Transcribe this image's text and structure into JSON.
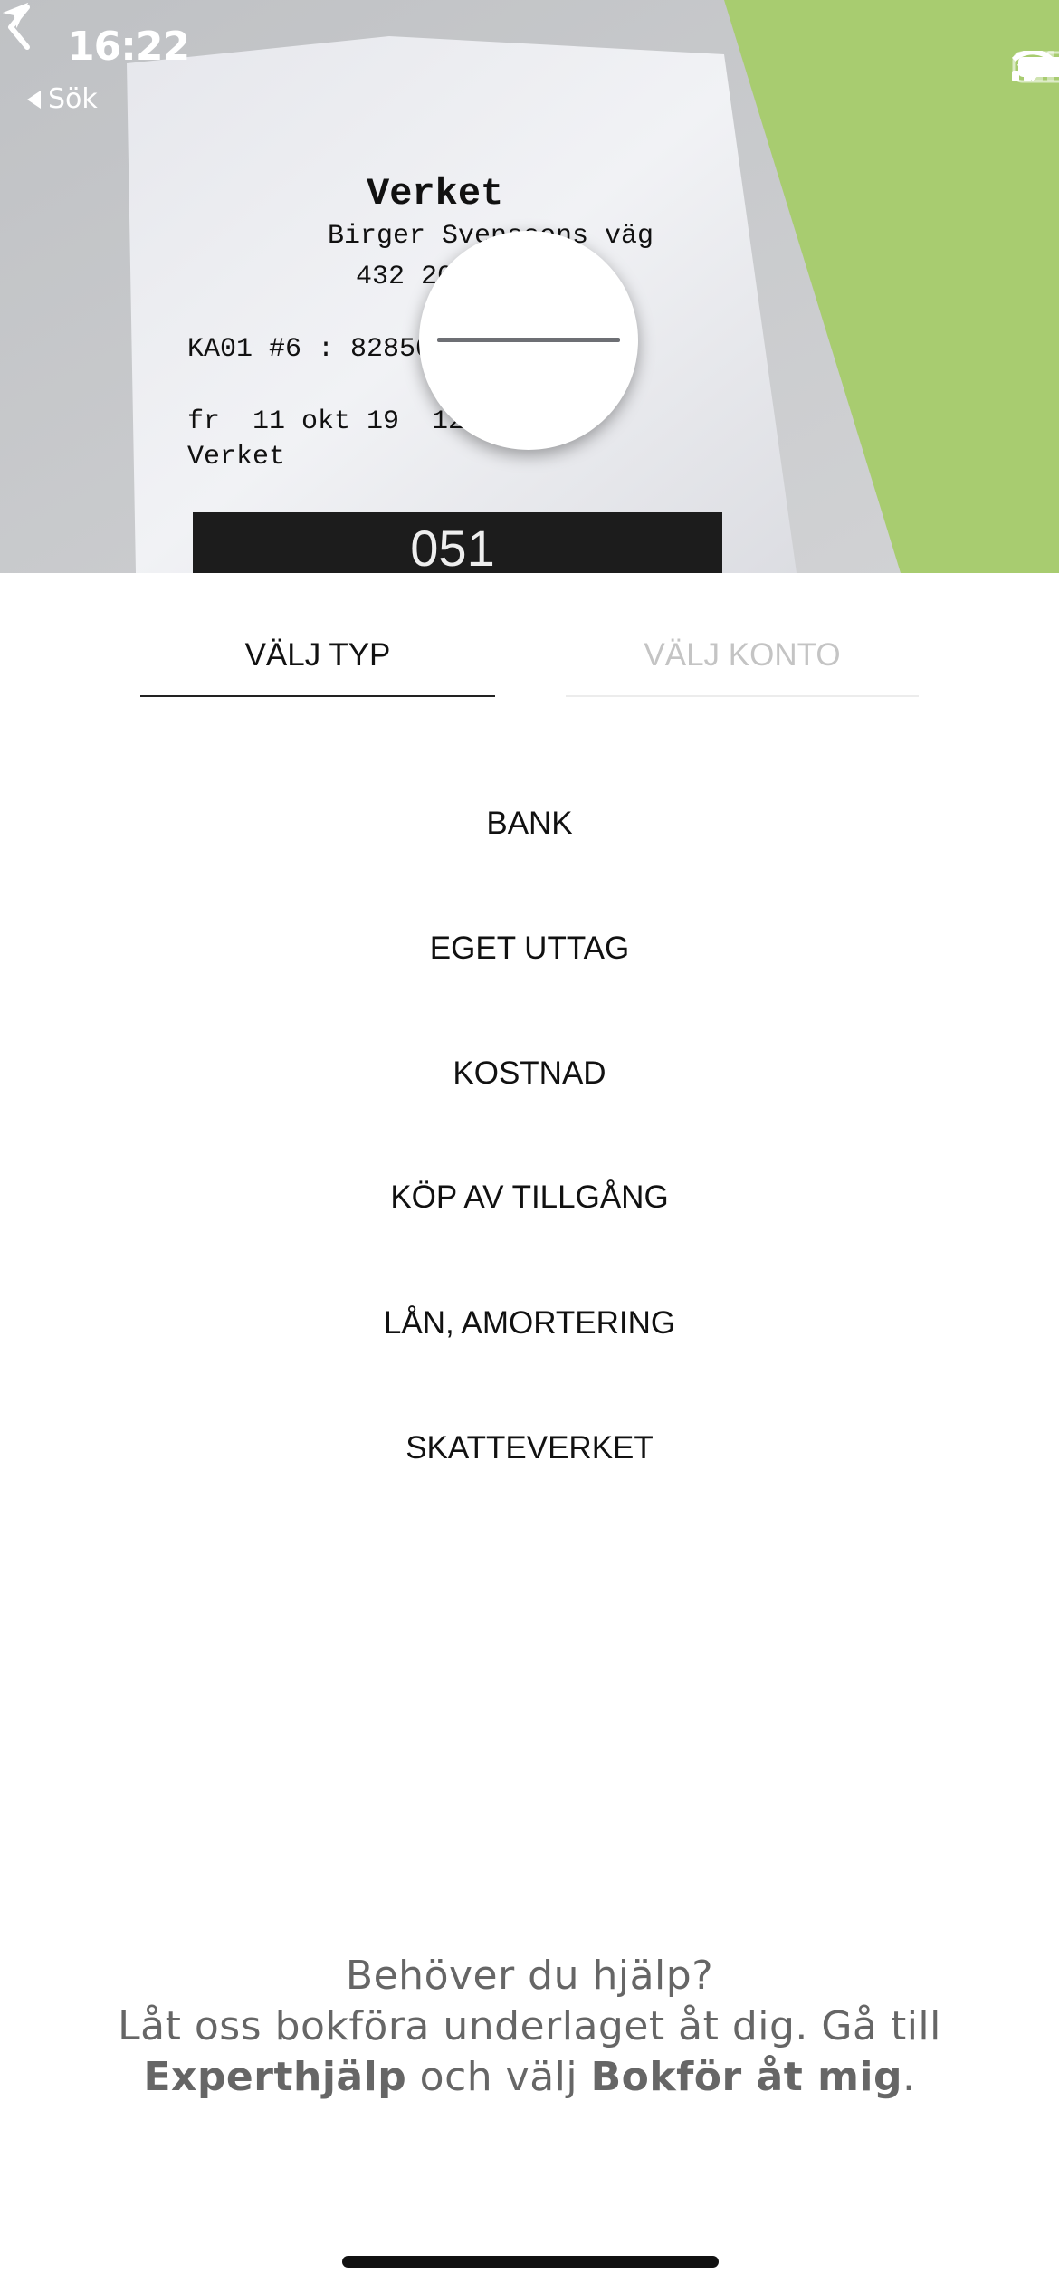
{
  "status_bar": {
    "time": "16:22",
    "back_app": "Sök"
  },
  "receipt": {
    "store": "Verket",
    "address": "Birger Svenssons väg",
    "postal": "432 20",
    "terminal": "KA01 #6 : 82850",
    "datetime": "fr  11 okt 19  12:02",
    "store2": "Verket",
    "number": "051"
  },
  "tabs": [
    {
      "label": "VÄLJ TYP",
      "active": true
    },
    {
      "label": "VÄLJ KONTO",
      "active": false
    }
  ],
  "types": [
    "BANK",
    "EGET UTTAG",
    "KOSTNAD",
    "KÖP AV TILLGÅNG",
    "LÅN, AMORTERING",
    "SKATTEVERKET"
  ],
  "help": {
    "line1": "Behöver du hjälp?",
    "line2": "Låt oss bokföra underlaget åt dig. Gå till",
    "bold1": "Experthjälp",
    "mid": " och välj ",
    "bold2": "Bokför åt mig",
    "end": "."
  },
  "colors": {
    "green": "#a8cc70",
    "text": "#111111",
    "muted": "#c4c4c4",
    "help": "#666666"
  }
}
